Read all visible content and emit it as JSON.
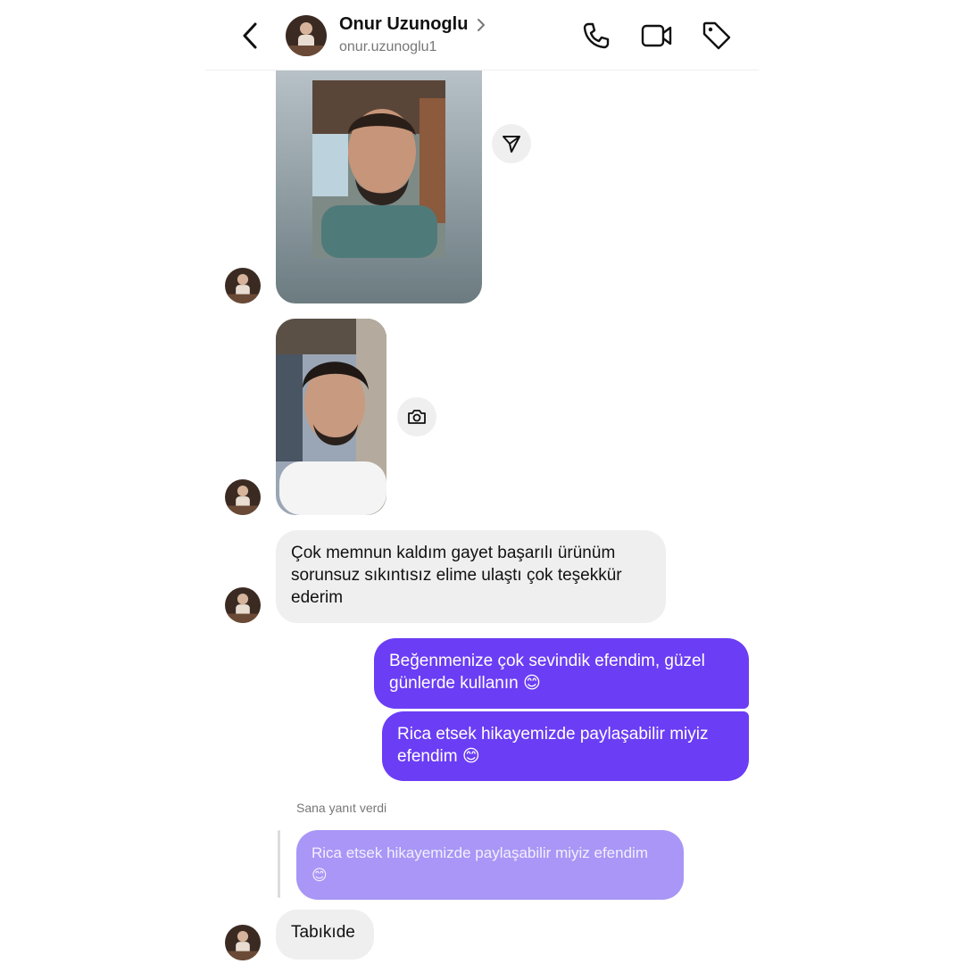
{
  "header": {
    "contact_name": "Onur Uzunoglu",
    "handle": "onur.uzunoglu1",
    "chevron": ">",
    "icons": {
      "back": "chevron-left-icon",
      "call": "phone-icon",
      "video": "video-camera-icon",
      "label": "tag-icon"
    }
  },
  "thread": {
    "shared_media": {
      "action_icon": "send-icon"
    },
    "photo_message": {
      "action_icon": "camera-icon"
    },
    "messages": [
      {
        "direction": "incoming",
        "text": "Çok memnun kaldım gayet başarılı ürünüm\nsorunsuz sıkıntısız elime ulaştı çok teşekkür\nederim"
      },
      {
        "direction": "outgoing",
        "text": "Beğenmenize çok sevindik efendim, güzel\ngünlerde kullanın 😊"
      },
      {
        "direction": "outgoing",
        "text": "Rica etsek hikayemizde paylaşabilir miyiz\nefendim 😊"
      }
    ],
    "reply": {
      "label": "Sana yanıt verdi",
      "quoted_text": "Rica etsek hikayemizde paylaşabilir miyiz efendim\n😊",
      "text": "Tabıkıde"
    }
  },
  "colors": {
    "outgoing_bubble": "#6b3df4",
    "quoted_bubble": "#a996f6",
    "incoming_bubble": "#efefef"
  }
}
